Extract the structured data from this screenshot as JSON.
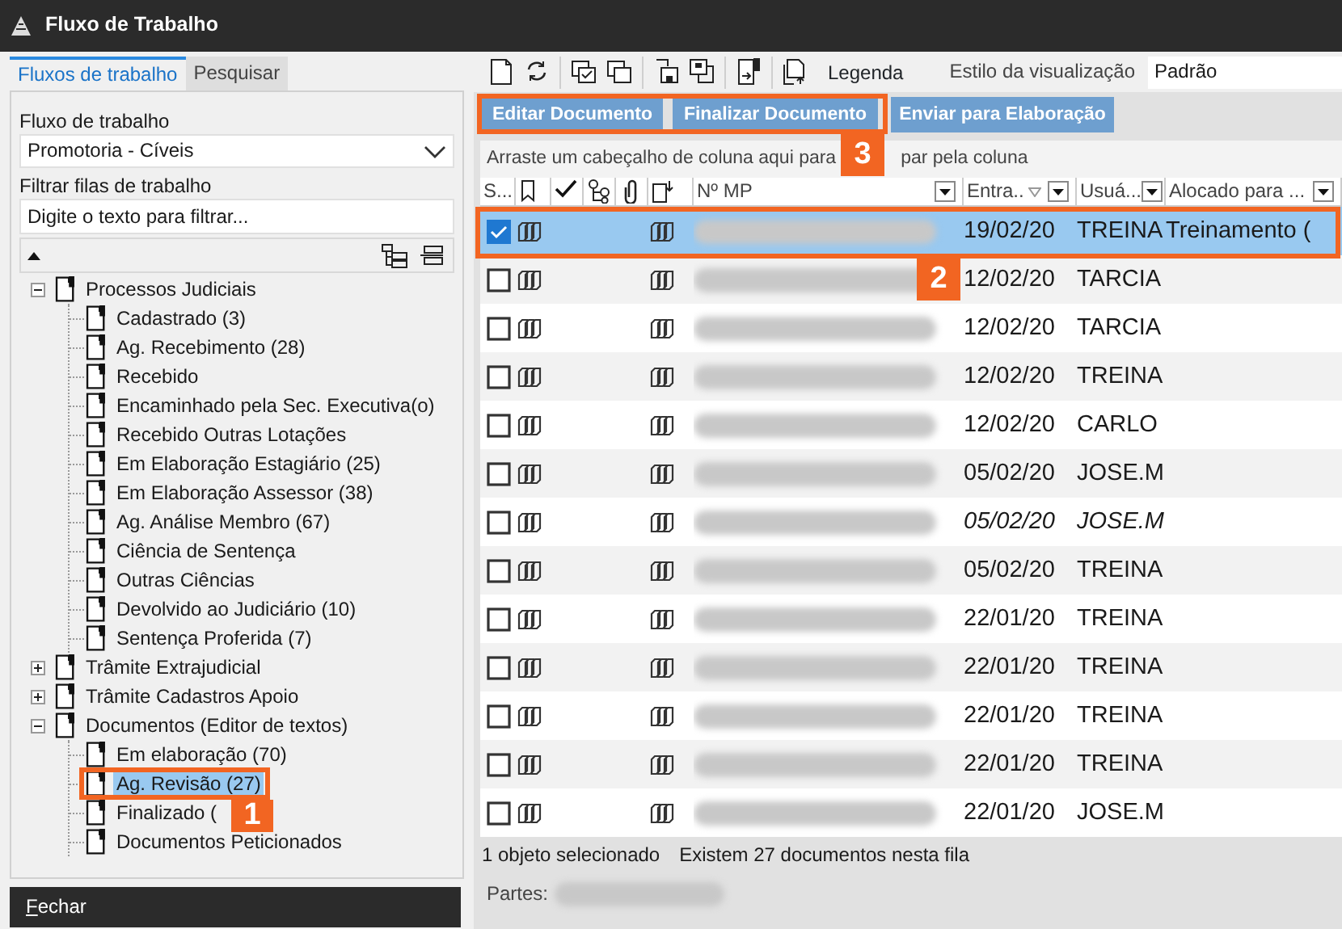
{
  "window": {
    "title": "Fluxo de Trabalho"
  },
  "left_tabs": [
    {
      "label": "Fluxos de trabalho",
      "selected": true
    },
    {
      "label": "Pesquisar",
      "selected": false
    }
  ],
  "workflow": {
    "label": "Fluxo de trabalho",
    "value": "Promotoria - Cíveis"
  },
  "filter": {
    "label": "Filtrar filas de trabalho",
    "placeholder": "Digite o texto para filtrar..."
  },
  "tree": [
    {
      "label": "Processos Judiciais",
      "expanded": true,
      "selected": false,
      "children": [
        {
          "label": "Cadastrado (3)",
          "selected": false
        },
        {
          "label": "Ag. Recebimento (28)",
          "selected": false
        },
        {
          "label": "Recebido",
          "selected": false
        },
        {
          "label": "Encaminhado pela Sec. Executiva(o)",
          "selected": false
        },
        {
          "label": "Recebido Outras Lotações",
          "selected": false
        },
        {
          "label": "Em Elaboração Estagiário (25)",
          "selected": false
        },
        {
          "label": "Em Elaboração Assessor (38)",
          "selected": false
        },
        {
          "label": "Ag. Análise Membro (67)",
          "selected": false
        },
        {
          "label": "Ciência de Sentença",
          "selected": false
        },
        {
          "label": "Outras Ciências",
          "selected": false
        },
        {
          "label": "Devolvido ao Judiciário (10)",
          "selected": false
        },
        {
          "label": "Sentença Proferida (7)",
          "selected": false
        }
      ]
    },
    {
      "label": "Trâmite Extrajudicial",
      "expanded": false,
      "selected": false
    },
    {
      "label": "Trâmite Cadastros Apoio",
      "expanded": false,
      "selected": false
    },
    {
      "label": "Documentos (Editor de textos)",
      "expanded": true,
      "selected": false,
      "children": [
        {
          "label": "Em elaboração (70)",
          "selected": false
        },
        {
          "label": "Ag. Revisão (27)",
          "selected": true
        },
        {
          "label": "Finalizado (",
          "selected": false
        },
        {
          "label": "Documentos Peticionados",
          "selected": false
        }
      ]
    }
  ],
  "close_button": "Fechar",
  "toolbar": {
    "legend": "Legenda",
    "view_style_label": "Estilo da visualização",
    "view_style": "Padrão"
  },
  "actions": [
    "Editar Documento",
    "Finalizar Documento",
    "Enviar para Elaboração"
  ],
  "group_hint": [
    "Arraste um cabeçalho de coluna aqui para",
    "par pela coluna"
  ],
  "columns": [
    {
      "kind": "text",
      "label": "S..."
    },
    {
      "kind": "icon"
    },
    {
      "kind": "icon"
    },
    {
      "kind": "icon"
    },
    {
      "kind": "icon"
    },
    {
      "kind": "icon"
    },
    {
      "kind": "text",
      "label": "Nº MP",
      "filter": true
    },
    {
      "kind": "text",
      "label": "Entra..",
      "sorted": true,
      "filter": true
    },
    {
      "kind": "text",
      "label": "Usuá...",
      "filter": true
    },
    {
      "kind": "text",
      "label": "Alocado para ...",
      "filter": true
    }
  ],
  "rows": [
    {
      "checked": true,
      "selected": true,
      "italic": false,
      "date": "19/02/20",
      "user": "TREINA",
      "allocated": "Treinamento ("
    },
    {
      "checked": false,
      "selected": false,
      "italic": false,
      "date": "12/02/20",
      "user": "TARCIA"
    },
    {
      "checked": false,
      "selected": false,
      "italic": false,
      "date": "12/02/20",
      "user": "TARCIA"
    },
    {
      "checked": false,
      "selected": false,
      "italic": false,
      "date": "12/02/20",
      "user": "TREINA"
    },
    {
      "checked": false,
      "selected": false,
      "italic": false,
      "date": "12/02/20",
      "user": "CARLO"
    },
    {
      "checked": false,
      "selected": false,
      "italic": false,
      "date": "05/02/20",
      "user": "JOSE.M"
    },
    {
      "checked": false,
      "selected": false,
      "italic": true,
      "date": "05/02/20",
      "user": "JOSE.M"
    },
    {
      "checked": false,
      "selected": false,
      "italic": false,
      "date": "05/02/20",
      "user": "TREINA"
    },
    {
      "checked": false,
      "selected": false,
      "italic": false,
      "date": "22/01/20",
      "user": "TREINA"
    },
    {
      "checked": false,
      "selected": false,
      "italic": false,
      "date": "22/01/20",
      "user": "TREINA"
    },
    {
      "checked": false,
      "selected": false,
      "italic": false,
      "date": "22/01/20",
      "user": "TREINA"
    },
    {
      "checked": false,
      "selected": false,
      "italic": false,
      "date": "22/01/20",
      "user": "TREINA"
    },
    {
      "checked": false,
      "selected": false,
      "italic": false,
      "date": "22/01/20",
      "user": "JOSE.M"
    }
  ],
  "status": [
    "1 objeto selecionado",
    "Existem 27 documentos nesta fila"
  ],
  "parts_label": "Partes:",
  "callouts": [
    {
      "number": "1"
    },
    {
      "number": "2"
    },
    {
      "number": "3"
    }
  ]
}
